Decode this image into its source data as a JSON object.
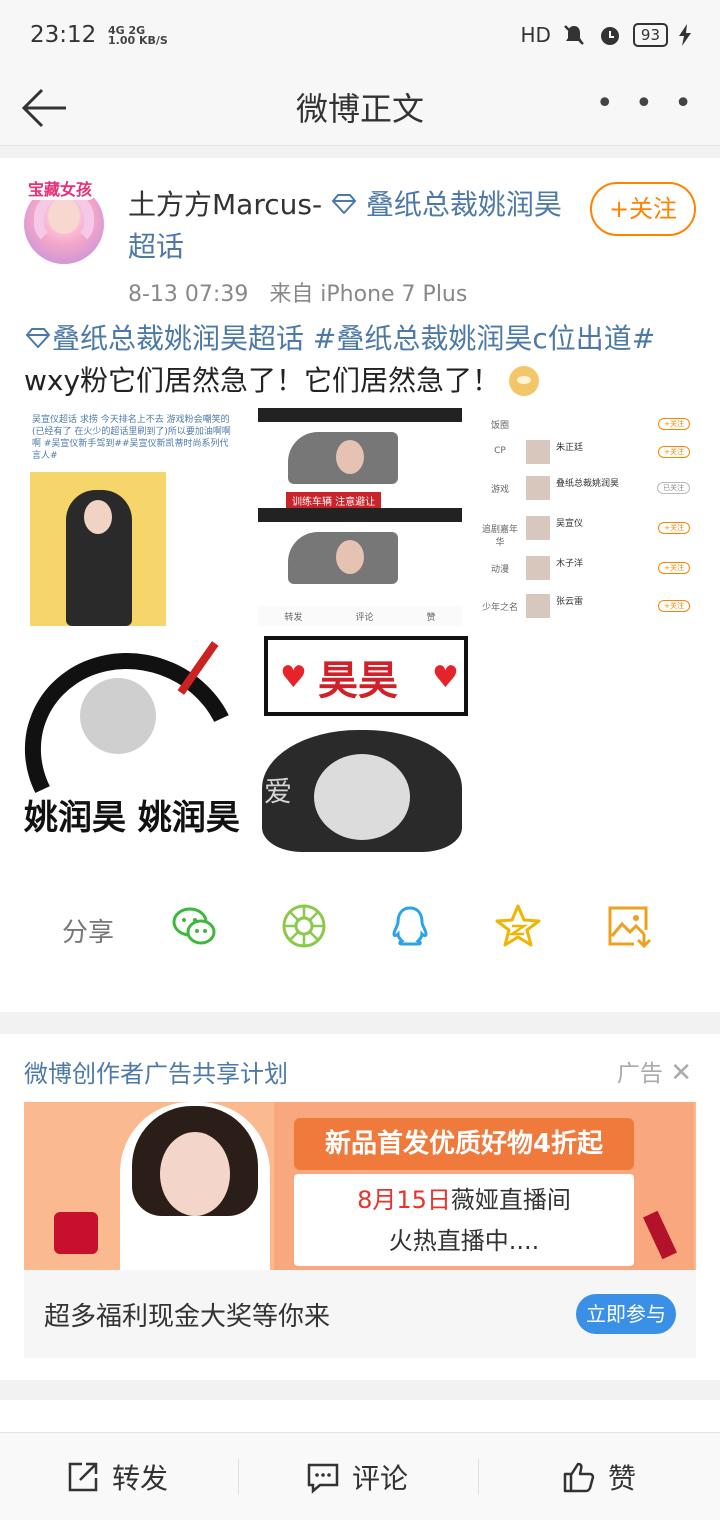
{
  "status_bar": {
    "time": "23:12",
    "network": "4G 2G",
    "speed": "1.00 KB/S",
    "hd": "HD",
    "battery": "93"
  },
  "nav": {
    "title": "微博正文",
    "more": "• • •",
    "back_icon": "arrow-left-icon"
  },
  "post": {
    "username": "土方方Marcus-",
    "topic": "叠纸总裁姚润昊超话",
    "time": "8-13 07:39",
    "source": "来自 iPhone 7 Plus",
    "follow_label": "+关注",
    "avatar_text": "宝藏女孩",
    "text_hash1": "叠纸总裁姚润昊超话",
    "text_hash2": "#叠纸总裁姚润昊c位出道#",
    "text_body": "wxy粉它们居然急了！它们居然急了！",
    "image1": {
      "text": "吴宣仪超话 求捞 今天排名上不去 游戏粉会嘲笑的(已经有了 在火少的超话里刷到了)所以要加油啊啊啊 #吴宣仪新手驾到##吴宣仪新凯蒂时尚系列代言人#"
    },
    "image2": {
      "sign_text": "训练车辆  注意避让",
      "repost": "转发",
      "comment": "评论",
      "like": "赞"
    },
    "image3": {
      "rows": [
        {
          "cat": "饭圈",
          "name": "",
          "follow": "+关注"
        },
        {
          "cat": "CP",
          "name": "朱正廷",
          "follow": "+关注"
        },
        {
          "cat": "游戏",
          "name": "叠纸总裁姚润昊",
          "follow": "已关注"
        },
        {
          "cat": "追剧嘉年华",
          "name": "吴宣仪",
          "follow": "+关注"
        },
        {
          "cat": "动漫",
          "name": "木子洋",
          "follow": "+关注"
        },
        {
          "cat": "少年之名",
          "name": "张云雷",
          "follow": "+关注"
        }
      ]
    },
    "image4": {
      "caption": "姚润昊  姚润昊"
    },
    "image5": {
      "title": "昊昊",
      "love": "爱"
    }
  },
  "share": {
    "label": "分享",
    "icons": [
      "wechat-icon",
      "moments-icon",
      "qq-icon",
      "qzone-icon",
      "save-image-icon"
    ]
  },
  "ad": {
    "title": "微博创作者广告共享计划",
    "label": "广告",
    "banner_headline": "新品首发优质好物4折起",
    "banner_date": "8月15日",
    "banner_line1_rest": "薇娅直播间",
    "banner_line2": "火热直播中....",
    "cta_text": "超多福利现金大奖等你来",
    "cta_button": "立即参与"
  },
  "tabs": {
    "repost": "转发",
    "comment": "评论",
    "like": "赞"
  },
  "bottom_bar": {
    "repost": "转发",
    "comment": "评论",
    "like": "赞"
  },
  "colors": {
    "accent_orange": "#ff8200",
    "link_blue": "#4d79a8",
    "cta_blue": "#3a8fe6"
  }
}
